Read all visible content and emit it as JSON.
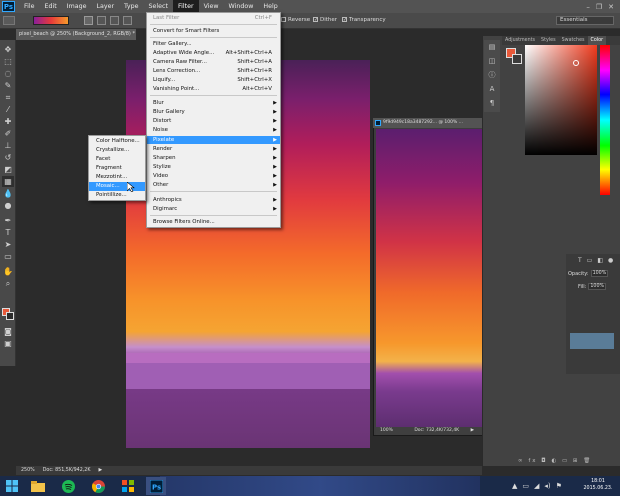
{
  "app": {
    "logo": "Ps",
    "menus": [
      "File",
      "Edit",
      "Image",
      "Layer",
      "Type",
      "Select",
      "Filter",
      "View",
      "Window",
      "Help"
    ],
    "active_menu": "Filter",
    "window_controls": [
      "–",
      "❐",
      "✕"
    ]
  },
  "options_bar": {
    "reverse_label": "Reverse",
    "dither_label": "Dither",
    "transparency_label": "Transparency",
    "workspace": "Essentials"
  },
  "document": {
    "tab_title": "pixel_beach @ 250% (Background_2, RGB/8) *",
    "zoom": "250%",
    "doc_size": "Doc: 851,5K/942,2K"
  },
  "second_window": {
    "title": "9f9d949c18a3487292... @ 100% ...",
    "zoom": "100%",
    "doc_size": "Doc: 732,4K/732,4K"
  },
  "filter_menu": {
    "items": [
      {
        "label": "Last Filter",
        "shortcut": "Ctrl+F",
        "disabled": true
      },
      {
        "label": "Convert for Smart Filters"
      },
      {
        "label": "Filter Gallery..."
      },
      {
        "label": "Adaptive Wide Angle...",
        "shortcut": "Alt+Shift+Ctrl+A"
      },
      {
        "label": "Camera Raw Filter...",
        "shortcut": "Shift+Ctrl+A"
      },
      {
        "label": "Lens Correction...",
        "shortcut": "Shift+Ctrl+R"
      },
      {
        "label": "Liquify...",
        "shortcut": "Shift+Ctrl+X"
      },
      {
        "label": "Vanishing Point...",
        "shortcut": "Alt+Ctrl+V"
      },
      {
        "label": "Blur",
        "submenu": true
      },
      {
        "label": "Blur Gallery",
        "submenu": true
      },
      {
        "label": "Distort",
        "submenu": true
      },
      {
        "label": "Noise",
        "submenu": true
      },
      {
        "label": "Pixelate",
        "submenu": true,
        "highlighted": true
      },
      {
        "label": "Render",
        "submenu": true
      },
      {
        "label": "Sharpen",
        "submenu": true
      },
      {
        "label": "Stylize",
        "submenu": true
      },
      {
        "label": "Video",
        "submenu": true
      },
      {
        "label": "Other",
        "submenu": true
      },
      {
        "label": "Anthropics",
        "submenu": true
      },
      {
        "label": "Digimarc",
        "submenu": true
      },
      {
        "label": "Browse Filters Online..."
      }
    ]
  },
  "pixelate_menu": {
    "items": [
      {
        "label": "Color Halftone..."
      },
      {
        "label": "Crystallize..."
      },
      {
        "label": "Facet"
      },
      {
        "label": "Fragment"
      },
      {
        "label": "Mezzotint..."
      },
      {
        "label": "Mosaic...",
        "highlighted": true
      },
      {
        "label": "Pointillize..."
      }
    ]
  },
  "panels": {
    "tabs": [
      "Adjustments",
      "Styles",
      "Swatches",
      "Color"
    ],
    "active_tab": "Color",
    "foreground_color": "#e8593a",
    "opacity_label": "Opacity:",
    "opacity_value": "100%",
    "fill_label": "Fill:",
    "fill_value": "100%"
  },
  "taskbar": {
    "apps": [
      "windows-start-icon",
      "file-explorer-icon",
      "spotify-icon",
      "chrome-icon",
      "apps-grid-icon",
      "photoshop-icon"
    ],
    "clock_time": "18:01",
    "clock_date": "2015.06.23."
  }
}
